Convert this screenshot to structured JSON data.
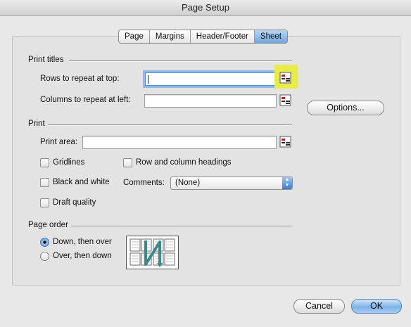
{
  "window": {
    "title": "Page Setup"
  },
  "tabs": [
    {
      "label": "Page",
      "active": false
    },
    {
      "label": "Margins",
      "active": false
    },
    {
      "label": "Header/Footer",
      "active": false
    },
    {
      "label": "Sheet",
      "active": true
    }
  ],
  "print_titles": {
    "heading": "Print titles",
    "rows_label": "Rows to repeat at top:",
    "rows_value": "",
    "columns_label": "Columns to repeat at left:",
    "columns_value": ""
  },
  "options_button": "Options...",
  "print": {
    "heading": "Print",
    "area_label": "Print area:",
    "area_value": "",
    "gridlines": {
      "label": "Gridlines",
      "checked": false
    },
    "row_col_headings": {
      "label": "Row and column headings",
      "checked": false
    },
    "black_white": {
      "label": "Black and white",
      "checked": false
    },
    "comments_label": "Comments:",
    "comments_value": "(None)",
    "draft_quality": {
      "label": "Draft quality",
      "checked": false
    }
  },
  "page_order": {
    "heading": "Page order",
    "down_then_over": {
      "label": "Down, then over",
      "selected": true
    },
    "over_then_down": {
      "label": "Over, then down",
      "selected": false
    }
  },
  "footer": {
    "cancel_label": "Cancel",
    "ok_label": "OK"
  },
  "colors": {
    "highlight": "#e7ec4a",
    "accent": "#5c98dc"
  },
  "icons": {
    "range_picker": "collapse-dialog-icon",
    "page_order": "page-order-diagram-icon"
  }
}
